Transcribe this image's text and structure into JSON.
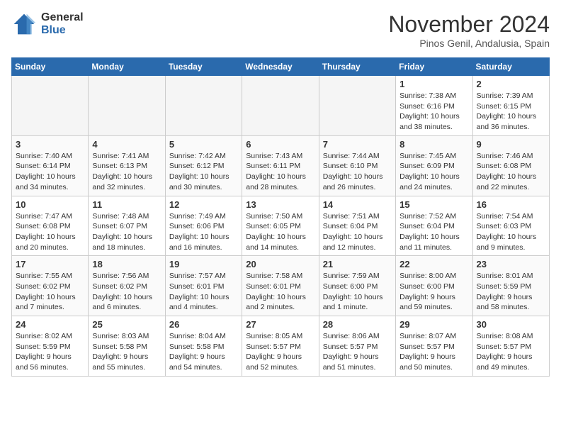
{
  "header": {
    "logo_general": "General",
    "logo_blue": "Blue",
    "month": "November 2024",
    "location": "Pinos Genil, Andalusia, Spain"
  },
  "weekdays": [
    "Sunday",
    "Monday",
    "Tuesday",
    "Wednesday",
    "Thursday",
    "Friday",
    "Saturday"
  ],
  "weeks": [
    [
      {
        "day": "",
        "info": ""
      },
      {
        "day": "",
        "info": ""
      },
      {
        "day": "",
        "info": ""
      },
      {
        "day": "",
        "info": ""
      },
      {
        "day": "",
        "info": ""
      },
      {
        "day": "1",
        "info": "Sunrise: 7:38 AM\nSunset: 6:16 PM\nDaylight: 10 hours and 38 minutes."
      },
      {
        "day": "2",
        "info": "Sunrise: 7:39 AM\nSunset: 6:15 PM\nDaylight: 10 hours and 36 minutes."
      }
    ],
    [
      {
        "day": "3",
        "info": "Sunrise: 7:40 AM\nSunset: 6:14 PM\nDaylight: 10 hours and 34 minutes."
      },
      {
        "day": "4",
        "info": "Sunrise: 7:41 AM\nSunset: 6:13 PM\nDaylight: 10 hours and 32 minutes."
      },
      {
        "day": "5",
        "info": "Sunrise: 7:42 AM\nSunset: 6:12 PM\nDaylight: 10 hours and 30 minutes."
      },
      {
        "day": "6",
        "info": "Sunrise: 7:43 AM\nSunset: 6:11 PM\nDaylight: 10 hours and 28 minutes."
      },
      {
        "day": "7",
        "info": "Sunrise: 7:44 AM\nSunset: 6:10 PM\nDaylight: 10 hours and 26 minutes."
      },
      {
        "day": "8",
        "info": "Sunrise: 7:45 AM\nSunset: 6:09 PM\nDaylight: 10 hours and 24 minutes."
      },
      {
        "day": "9",
        "info": "Sunrise: 7:46 AM\nSunset: 6:08 PM\nDaylight: 10 hours and 22 minutes."
      }
    ],
    [
      {
        "day": "10",
        "info": "Sunrise: 7:47 AM\nSunset: 6:08 PM\nDaylight: 10 hours and 20 minutes."
      },
      {
        "day": "11",
        "info": "Sunrise: 7:48 AM\nSunset: 6:07 PM\nDaylight: 10 hours and 18 minutes."
      },
      {
        "day": "12",
        "info": "Sunrise: 7:49 AM\nSunset: 6:06 PM\nDaylight: 10 hours and 16 minutes."
      },
      {
        "day": "13",
        "info": "Sunrise: 7:50 AM\nSunset: 6:05 PM\nDaylight: 10 hours and 14 minutes."
      },
      {
        "day": "14",
        "info": "Sunrise: 7:51 AM\nSunset: 6:04 PM\nDaylight: 10 hours and 12 minutes."
      },
      {
        "day": "15",
        "info": "Sunrise: 7:52 AM\nSunset: 6:04 PM\nDaylight: 10 hours and 11 minutes."
      },
      {
        "day": "16",
        "info": "Sunrise: 7:54 AM\nSunset: 6:03 PM\nDaylight: 10 hours and 9 minutes."
      }
    ],
    [
      {
        "day": "17",
        "info": "Sunrise: 7:55 AM\nSunset: 6:02 PM\nDaylight: 10 hours and 7 minutes."
      },
      {
        "day": "18",
        "info": "Sunrise: 7:56 AM\nSunset: 6:02 PM\nDaylight: 10 hours and 6 minutes."
      },
      {
        "day": "19",
        "info": "Sunrise: 7:57 AM\nSunset: 6:01 PM\nDaylight: 10 hours and 4 minutes."
      },
      {
        "day": "20",
        "info": "Sunrise: 7:58 AM\nSunset: 6:01 PM\nDaylight: 10 hours and 2 minutes."
      },
      {
        "day": "21",
        "info": "Sunrise: 7:59 AM\nSunset: 6:00 PM\nDaylight: 10 hours and 1 minute."
      },
      {
        "day": "22",
        "info": "Sunrise: 8:00 AM\nSunset: 6:00 PM\nDaylight: 9 hours and 59 minutes."
      },
      {
        "day": "23",
        "info": "Sunrise: 8:01 AM\nSunset: 5:59 PM\nDaylight: 9 hours and 58 minutes."
      }
    ],
    [
      {
        "day": "24",
        "info": "Sunrise: 8:02 AM\nSunset: 5:59 PM\nDaylight: 9 hours and 56 minutes."
      },
      {
        "day": "25",
        "info": "Sunrise: 8:03 AM\nSunset: 5:58 PM\nDaylight: 9 hours and 55 minutes."
      },
      {
        "day": "26",
        "info": "Sunrise: 8:04 AM\nSunset: 5:58 PM\nDaylight: 9 hours and 54 minutes."
      },
      {
        "day": "27",
        "info": "Sunrise: 8:05 AM\nSunset: 5:57 PM\nDaylight: 9 hours and 52 minutes."
      },
      {
        "day": "28",
        "info": "Sunrise: 8:06 AM\nSunset: 5:57 PM\nDaylight: 9 hours and 51 minutes."
      },
      {
        "day": "29",
        "info": "Sunrise: 8:07 AM\nSunset: 5:57 PM\nDaylight: 9 hours and 50 minutes."
      },
      {
        "day": "30",
        "info": "Sunrise: 8:08 AM\nSunset: 5:57 PM\nDaylight: 9 hours and 49 minutes."
      }
    ]
  ]
}
